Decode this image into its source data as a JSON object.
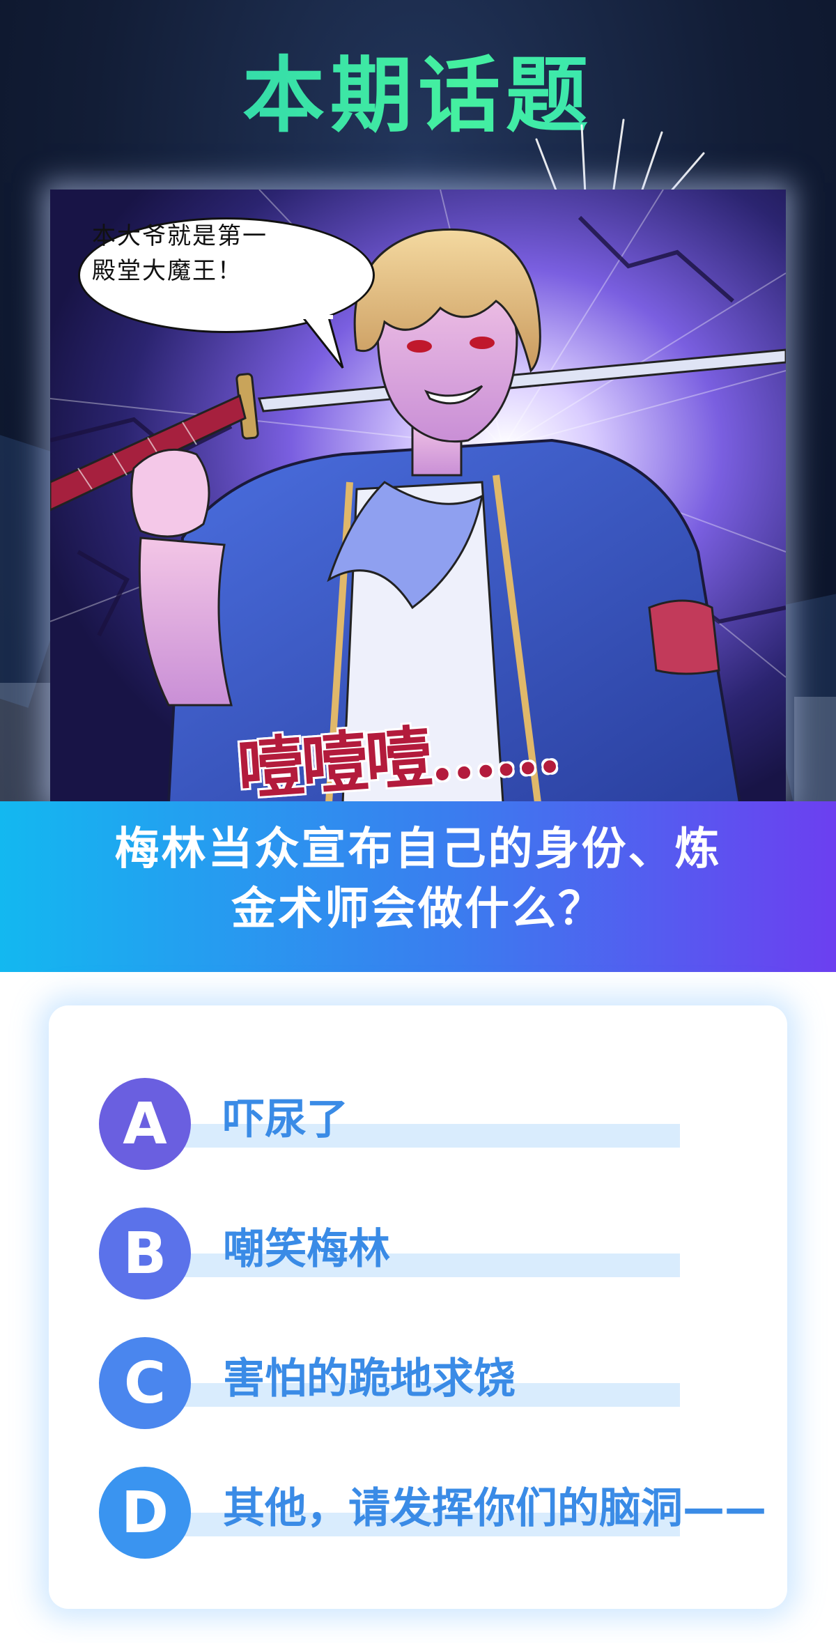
{
  "header": {
    "title": "本期话题"
  },
  "panel": {
    "bubble_lines": [
      "本大爷就是第一",
      "殿堂大魔王！"
    ],
    "sfx_text": "噎噎噎……"
  },
  "question": {
    "lines": [
      "梅林当众宣布自己的身份、炼",
      "金术师会做什么？"
    ]
  },
  "options": [
    {
      "letter": "A",
      "text": "吓尿了",
      "circle_color": "#6a5fe0"
    },
    {
      "letter": "B",
      "text": "嘲笑梅林",
      "circle_color": "#5b72ea"
    },
    {
      "letter": "C",
      "text": "害怕的跪地求饶",
      "circle_color": "#4a86ee"
    },
    {
      "letter": "D",
      "text": "其他，请发挥你们的脑洞——",
      "circle_color": "#3a94f0"
    }
  ],
  "colors": {
    "title_green": "#39e3a3",
    "banner_start": "#13b8f0",
    "banner_end": "#6c3ff0",
    "option_text": "#3a8be6",
    "option_strip": "#d9ecfd"
  }
}
